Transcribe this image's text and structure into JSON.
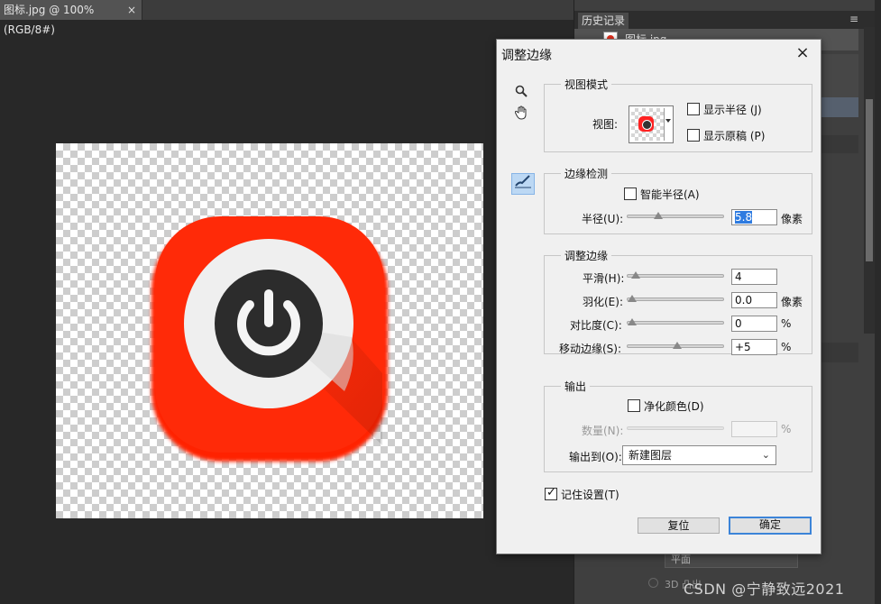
{
  "document": {
    "tab_title": "图标.jpg @ 100%(RGB/8#)",
    "tab_close": "×"
  },
  "history_panel": {
    "tab_label": "历史记录",
    "item_label": "图标.jpg",
    "menu_icon": "≡"
  },
  "background_panel": {
    "dropdown_value": "平面",
    "option_3d": "3D 凸出"
  },
  "watermark": "CSDN @宁静致远2021",
  "dialog": {
    "title": "调整边缘",
    "close_icon": "×",
    "view_mode": {
      "group_title": "视图模式",
      "view_label": "视图:",
      "show_radius": {
        "label": "显示半径 (J)",
        "checked": false
      },
      "show_original": {
        "label": "显示原稿 (P)",
        "checked": false
      }
    },
    "edge_detection": {
      "group_title": "边缘检测",
      "smart_radius": {
        "label": "智能半径(A)",
        "checked": false
      },
      "radius": {
        "label": "半径(U):",
        "value": "5.8",
        "unit": "像素",
        "fraction": 0.3
      }
    },
    "adjust_edge": {
      "group_title": "调整边缘",
      "rows": [
        {
          "label": "平滑(H):",
          "value": "4",
          "unit": "",
          "fraction": 0.04
        },
        {
          "label": "羽化(E):",
          "value": "0.0",
          "unit": "像素",
          "fraction": 0.0
        },
        {
          "label": "对比度(C):",
          "value": "0",
          "unit": "%",
          "fraction": 0.0
        },
        {
          "label": "移动边缘(S):",
          "value": "+5",
          "unit": "%",
          "fraction": 0.52
        }
      ]
    },
    "output": {
      "group_title": "输出",
      "decontaminate": {
        "label": "净化颜色(D)",
        "checked": false
      },
      "amount": {
        "label": "数量(N):",
        "value": "",
        "unit": "%"
      },
      "output_to_label": "输出到(O):",
      "output_to_value": "新建图层"
    },
    "remember": {
      "label": "记住设置(T)",
      "checked": true
    },
    "reset_label": "复位",
    "ok_label": "确定"
  },
  "colors": {
    "icon_red": "#ff2405",
    "icon_white": "#efefef",
    "icon_dark": "#2c2c2c",
    "dialog_bg": "#f0f0f0",
    "selection_blue": "#2e7be0"
  }
}
